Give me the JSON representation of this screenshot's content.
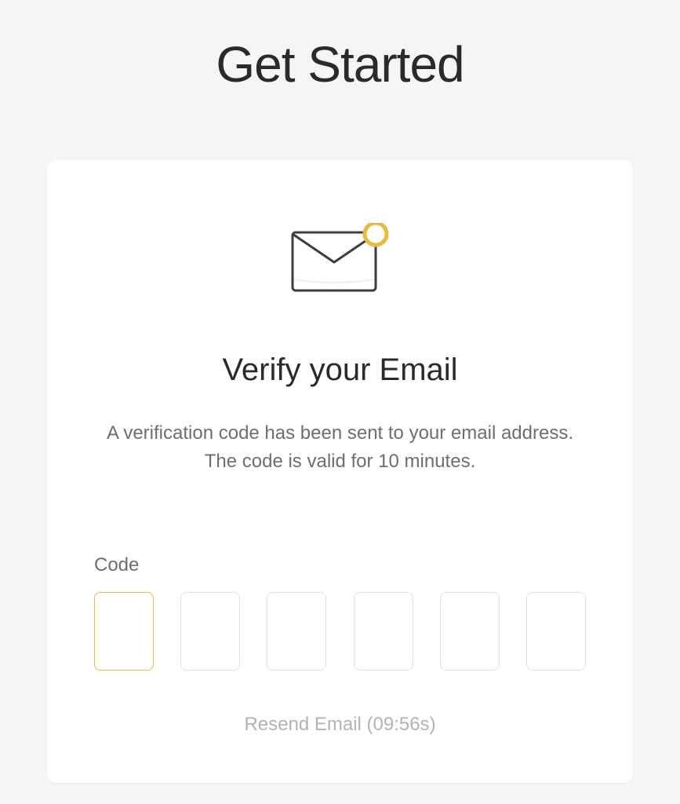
{
  "page": {
    "title": "Get Started"
  },
  "card": {
    "title": "Verify your Email",
    "description_line1": "A verification code has been sent to your email address.",
    "description_line2": "The code is valid for 10 minutes."
  },
  "code": {
    "label": "Code",
    "values": [
      "",
      "",
      "",
      "",
      "",
      ""
    ]
  },
  "resend": {
    "prefix": "Resend Email (",
    "timer": "09:56s",
    "suffix": ")"
  },
  "colors": {
    "accent": "#e8b93d",
    "icon_stroke": "#3a3d44"
  }
}
